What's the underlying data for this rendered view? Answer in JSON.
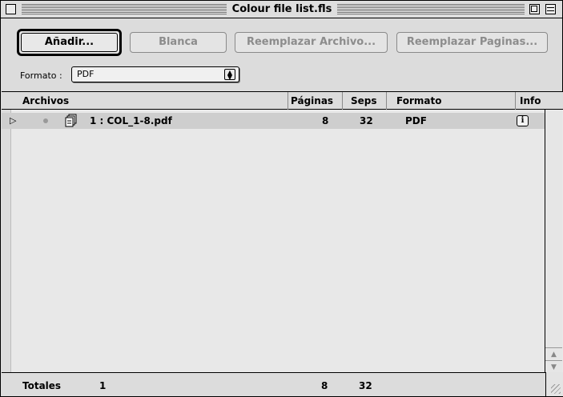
{
  "window": {
    "title": "Colour file list.fls"
  },
  "toolbar": {
    "add_label": "Añadir...",
    "blank_label": "Blanca",
    "replace_file_label": "Reemplazar Archivo...",
    "replace_pages_label": "Reemplazar Paginas..."
  },
  "format": {
    "label": "Formato :",
    "selected": "PDF"
  },
  "table": {
    "headers": {
      "files": "Archivos",
      "pages": "Páginas",
      "seps": "Seps",
      "format": "Formato",
      "info": "Info"
    },
    "rows": [
      {
        "name": "1 : COL_1-8.pdf",
        "pages": "8",
        "seps": "32",
        "format": "PDF"
      }
    ]
  },
  "totals": {
    "label": "Totales",
    "files": "1",
    "pages": "8",
    "seps": "32"
  },
  "colors": {
    "window_bg": "#dcdcdc",
    "list_bg": "#e8e8e8",
    "selected_row": "#cecece",
    "disabled_text": "#8c8c8c"
  }
}
